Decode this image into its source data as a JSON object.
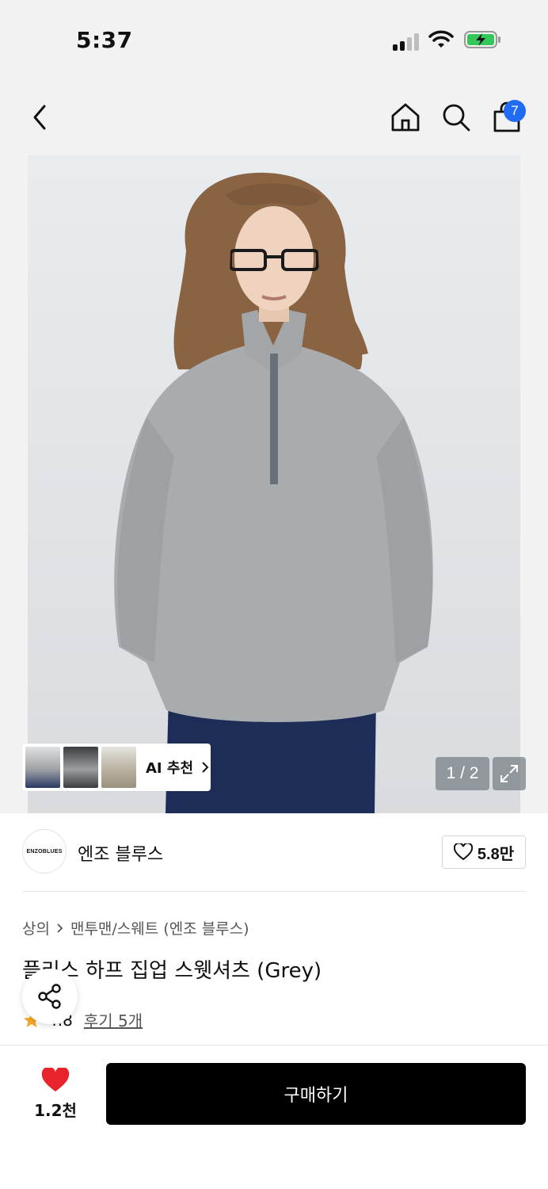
{
  "status_bar": {
    "time": "5:37"
  },
  "nav": {
    "cart_count": "7"
  },
  "gallery": {
    "ai_label": "AI 추천",
    "page_indicator": "1 / 2"
  },
  "brand": {
    "logo_text": "ENZOBLUES",
    "name": "엔조 블루스",
    "like_count": "5.8만"
  },
  "product": {
    "breadcrumb": [
      "상의",
      "맨투맨/스웨트 (엔조 블루스)"
    ],
    "title": "플리스 하프 집업 스웻셔츠 (Grey)",
    "rating": "4.8",
    "review_link": "후기 5개"
  },
  "bottom_bar": {
    "wish_count": "1.2천",
    "buy_label": "구매하기"
  },
  "colors": {
    "accent_blue": "#1f6bf2",
    "heart_red": "#e8232c",
    "star": "#f5a623",
    "buy_button": "#000000"
  }
}
